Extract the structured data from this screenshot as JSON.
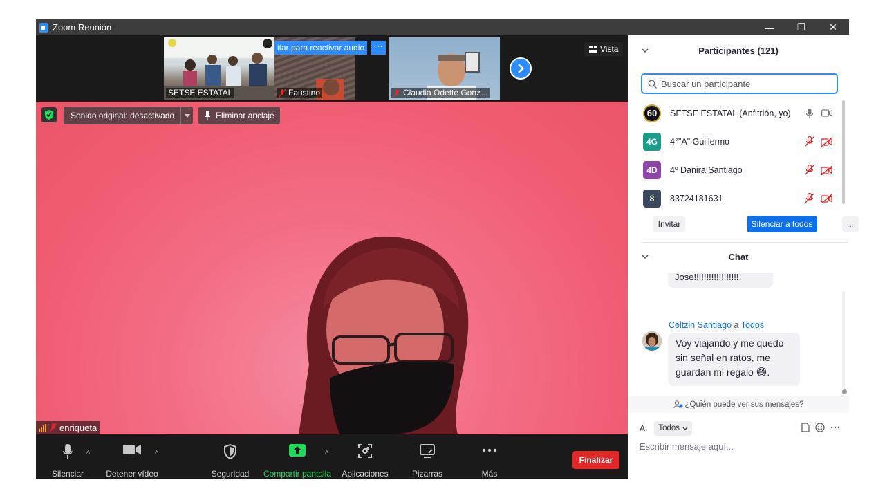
{
  "window": {
    "title": "Zoom Reunión",
    "controls": {
      "minimize": "—",
      "restore": "❐",
      "close": "✕"
    }
  },
  "strip": {
    "thumbnails": [
      {
        "name": "SETSE ESTATAL"
      },
      {
        "name": "Faustino"
      },
      {
        "name": "Claudia Odette Gonz..."
      }
    ],
    "reactivate_audio": "itar para reactivar audio",
    "more": "···",
    "view_label": "Vista"
  },
  "main_video": {
    "sound_label": "Sonido original: desactivado",
    "unpin_label": "Eliminar anclaje",
    "speaker_name": "enriqueta"
  },
  "toolbar": {
    "mute": "Silenciar",
    "stop_video": "Detener vídeo",
    "security": "Seguridad",
    "share": "Compartir pantalla",
    "apps": "Aplicaciones",
    "whiteboards": "Pizarras",
    "more": "Más",
    "end": "Finalizar"
  },
  "participants": {
    "header": "Participantes (121)",
    "search_placeholder": "Buscar un participante",
    "list": [
      {
        "avatar": "60",
        "name": "SETSE ESTATAL (Anfitrión, yo)",
        "color": "#111111"
      },
      {
        "avatar": "4G",
        "name": "4°\"A\" Guillermo",
        "color": "#1a9e8a"
      },
      {
        "avatar": "4D",
        "name": "4º Danira Santiago",
        "color": "#8e44ad"
      },
      {
        "avatar": "8",
        "name": "83724181631",
        "color": "#3a4a5c"
      }
    ],
    "invite": "Invitar",
    "mute_all": "Silenciar a todos",
    "more": "..."
  },
  "chat": {
    "header": "Chat",
    "prev_message": "Jose!!!!!!!!!!!!!!!!!!",
    "sender": "Celtzin Santiago",
    "to_word": "a",
    "recipient": "Todos",
    "message_lines": [
      "Voy viajando y me quedo",
      "sin señal en ratos,  me",
      "guardan mi regalo"
    ],
    "emoji": "😄",
    "message_end": ".",
    "who_can_see": "¿Quién puede ver sus mensajes?",
    "to_label": "A:",
    "to_value": "Todos",
    "input_placeholder": "Escribir mensaje aquí..."
  },
  "colors": {
    "accent": "#2d8cff",
    "end": "#e02828",
    "share": "#23d959",
    "muted": "#e02828"
  }
}
